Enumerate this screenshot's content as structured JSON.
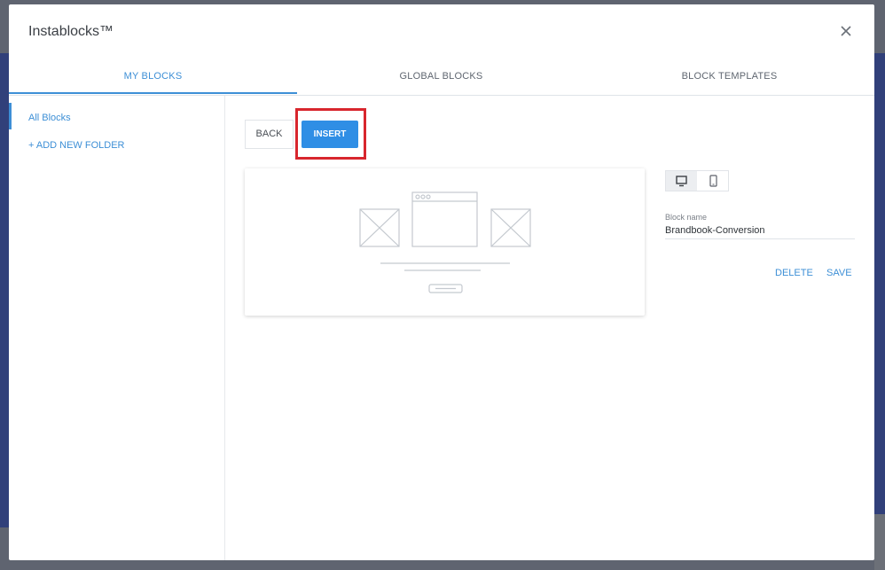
{
  "window": {
    "title": "Instablocks™"
  },
  "tabs": [
    {
      "label": "MY BLOCKS",
      "active": true
    },
    {
      "label": "GLOBAL BLOCKS",
      "active": false
    },
    {
      "label": "BLOCK TEMPLATES",
      "active": false
    }
  ],
  "sidebar": {
    "items": [
      {
        "label": "All Blocks",
        "active": true
      },
      {
        "label": "+ ADD NEW FOLDER",
        "active": false
      }
    ]
  },
  "toolbar": {
    "back_label": "BACK",
    "insert_label": "INSERT"
  },
  "device_toggle": {
    "selected": "desktop",
    "options": [
      "desktop-icon",
      "mobile-icon"
    ]
  },
  "block": {
    "name_label": "Block name",
    "name_value": "Brandbook-Conversion"
  },
  "actions": {
    "delete_label": "DELETE",
    "save_label": "SAVE"
  },
  "colors": {
    "accent": "#2f8ee5",
    "highlight": "#d8262d",
    "link": "#3d8fd6"
  }
}
